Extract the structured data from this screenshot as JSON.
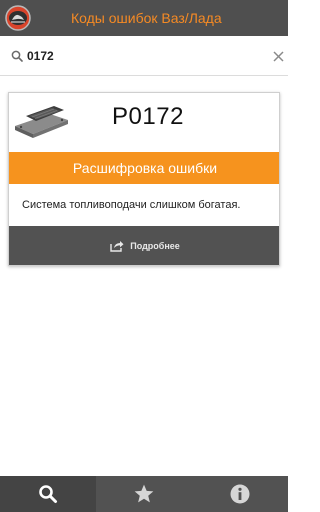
{
  "app_bar": {
    "title": "Коды ошибок Ваз/Лада",
    "logo_icon": "lada-logo-icon"
  },
  "search": {
    "value": "0172",
    "icon": "search-icon",
    "clear_icon": "close-icon"
  },
  "result": {
    "code": "P0172",
    "image_icon": "ecu-module-icon",
    "decode_label": "Расшифровка ошибки",
    "description": "Система топливоподачи слишком богатая.",
    "more_label": "Подробнее",
    "more_icon": "share-icon"
  },
  "bottom_nav": {
    "items": [
      {
        "icon": "search-icon",
        "active": true
      },
      {
        "icon": "star-icon",
        "active": false
      },
      {
        "icon": "info-icon",
        "active": false
      }
    ]
  },
  "colors": {
    "accent": "#f6931e",
    "title": "#f58a24",
    "bar": "#4f4f4f",
    "dark_panel": "#525252"
  }
}
